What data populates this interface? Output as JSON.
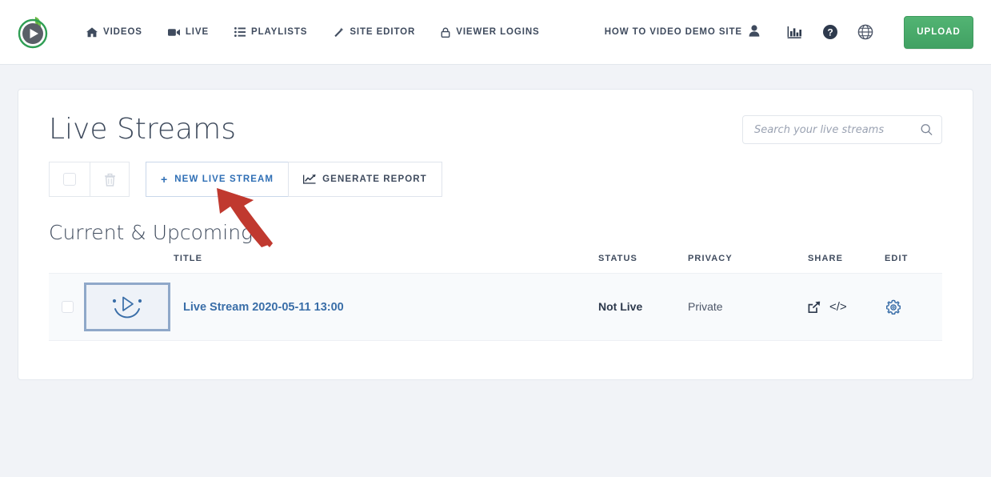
{
  "header": {
    "logo_name": "vidrack-play-leaf-logo",
    "nav": [
      {
        "label": "VIDEOS",
        "icon": "home-icon"
      },
      {
        "label": "LIVE",
        "icon": "video-camera-icon"
      },
      {
        "label": "PLAYLISTS",
        "icon": "list-icon"
      },
      {
        "label": "SITE EDITOR",
        "icon": "magic-wand-icon"
      },
      {
        "label": "VIEWER LOGINS",
        "icon": "lock-icon"
      }
    ],
    "account_label": "HOW TO VIDEO DEMO SITE",
    "account_icon": "user-avatar-icon",
    "icons": [
      {
        "name": "analytics-bar-chart-icon"
      },
      {
        "name": "help-question-icon"
      },
      {
        "name": "globe-language-icon"
      }
    ],
    "upload_label": "UPLOAD",
    "upload_color": "#48a868"
  },
  "search": {
    "placeholder": "Search your live streams",
    "value": "",
    "icon": "search-icon"
  },
  "main": {
    "page_title": "Live Streams",
    "section_title": "Current & Upcoming"
  },
  "toolbar": {
    "select_all_icon": "checkbox-icon",
    "delete_icon": "trash-icon",
    "new_live_stream_label": "NEW LIVE STREAM",
    "new_live_stream_plus": "+",
    "new_live_stream_color": "#2f6fb5",
    "generate_report_label": "GENERATE REPORT",
    "generate_report_icon": "line-chart-icon"
  },
  "table": {
    "columns": [
      {
        "key": "check",
        "label": ""
      },
      {
        "key": "thumb",
        "label": ""
      },
      {
        "key": "title",
        "label": "TITLE"
      },
      {
        "key": "status",
        "label": "STATUS"
      },
      {
        "key": "privacy",
        "label": "PRIVACY"
      },
      {
        "key": "share",
        "label": "SHARE"
      },
      {
        "key": "edit",
        "label": "EDIT"
      }
    ],
    "rows": [
      {
        "title": "Live Stream 2020-05-11 13:00",
        "status": "Not Live",
        "privacy": "Private",
        "thumbnail_icon": "video-placeholder-smiley-icon",
        "share_icon": "share-export-icon",
        "embed_icon": "</>",
        "edit_icon": "gear-icon"
      }
    ]
  },
  "annotation": {
    "arrow_color": "#c0392f",
    "points_to": "new-live-stream-button"
  }
}
